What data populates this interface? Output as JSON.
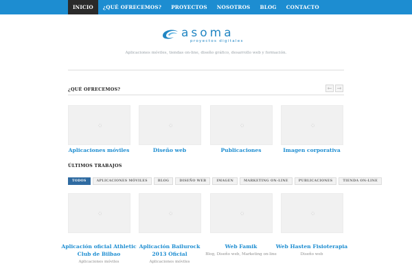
{
  "nav": {
    "items": [
      "INICIO",
      "¿QUÉ OFRECEMOS?",
      "PROYECTOS",
      "NOSOTROS",
      "BLOG",
      "CONTACTO"
    ],
    "active": "INICIO"
  },
  "brand": {
    "name": "asoma",
    "subtitle": "proyectos digitales",
    "tagline": "Aplicaciones móviles, tiendas on-line, diseño gráfico, desarrollo web y formación.",
    "color": "#2286c3"
  },
  "services": {
    "heading": "¿QUÉ OFRECEMOS?",
    "prev_icon": "arrow-left-icon",
    "next_icon": "arrow-right-icon",
    "prev_glyph": "←",
    "next_glyph": "→",
    "items": [
      {
        "title": "Aplicaciones móviles"
      },
      {
        "title": "Diseño web"
      },
      {
        "title": "Publicaciones"
      },
      {
        "title": "Imagen corporativa"
      }
    ]
  },
  "works": {
    "heading": "ÚLTIMOS TRABAJOS",
    "filters": [
      "TODOS",
      "APLICACIONES MÓVILES",
      "BLOG",
      "DISEÑO WEB",
      "IMAGEN",
      "MARKETING ON-LINE",
      "PUBLICACIONES",
      "TIENDA ON-LINE"
    ],
    "active_filter": "TODOS",
    "items": [
      {
        "title": "Aplicación oficial Athletic Club de Bilbao",
        "category": "Aplicaciones móviles"
      },
      {
        "title": "Aplicación Bailurock 2013 Oficial",
        "category": "Aplicaciones móviles"
      },
      {
        "title": "Web Famik",
        "category": "Blog, Diseño web, Marketing on-line"
      },
      {
        "title": "Web Hasten Fisioterapia",
        "category": "Diseño web"
      }
    ]
  },
  "loader": {
    "glyph": "◌",
    "icon": "loading-spinner-icon"
  },
  "colors": {
    "nav_bg": "#1d8dd1",
    "nav_active": "#2a2a2a",
    "link": "#1d8dd1",
    "chip_active": "#2f6ba1"
  }
}
